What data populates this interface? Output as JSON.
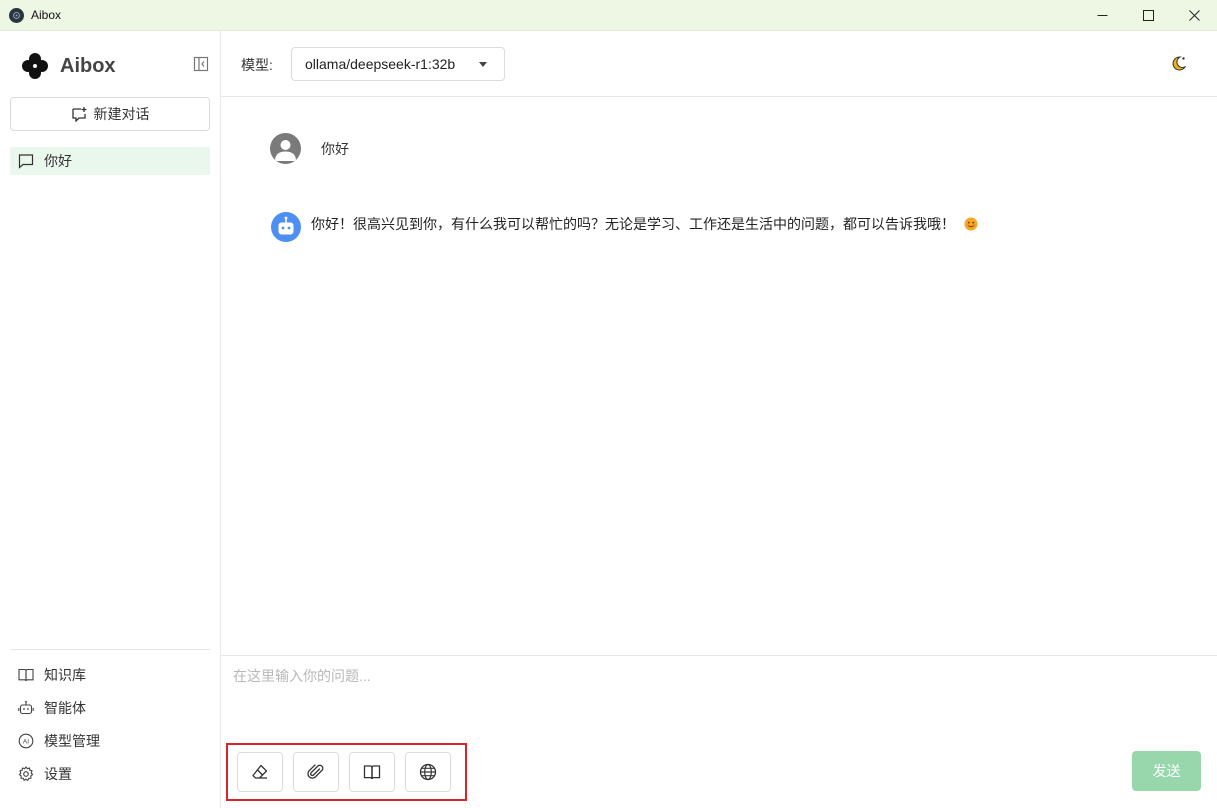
{
  "window": {
    "title": "Aibox"
  },
  "sidebar": {
    "brand": "Aibox",
    "new_chat_label": "新建对话",
    "conversations": [
      {
        "label": "你好"
      }
    ],
    "menu": [
      {
        "label": "知识库",
        "icon": "book-icon"
      },
      {
        "label": "智能体",
        "icon": "robot-icon"
      },
      {
        "label": "模型管理",
        "icon": "ai-icon"
      },
      {
        "label": "设置",
        "icon": "gear-icon"
      }
    ]
  },
  "topbar": {
    "model_label": "模型:",
    "model_selected": "ollama/deepseek-r1:32b"
  },
  "messages": [
    {
      "role": "user",
      "text": "你好"
    },
    {
      "role": "assistant",
      "text": "你好！很高兴见到你，有什么我可以帮忙的吗？无论是学习、工作还是生活中的问题，都可以告诉我哦！"
    }
  ],
  "composer": {
    "placeholder": "在这里输入你的问题...",
    "tools": [
      "eraser-icon",
      "paperclip-icon",
      "book-icon",
      "globe-icon"
    ],
    "send_label": "发送"
  },
  "colors": {
    "titlebar": "#eef6e4",
    "selected_item": "#e9f7ec",
    "send_button": "#98d6ac",
    "bot_avatar": "#4d8ff2",
    "highlight_box": "#d9242b"
  }
}
